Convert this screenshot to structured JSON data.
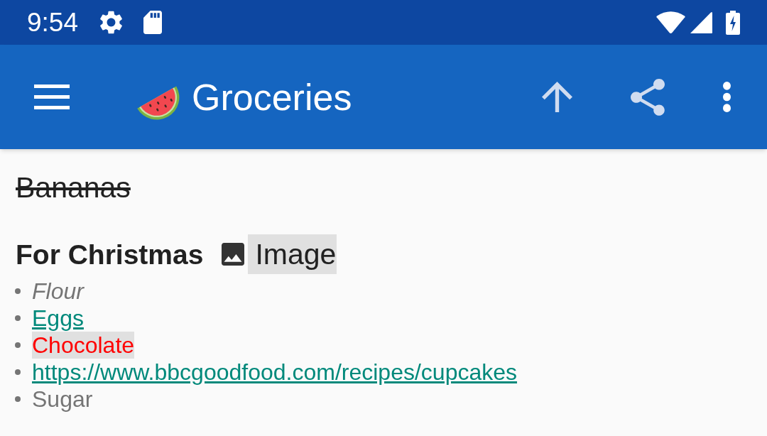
{
  "status_bar": {
    "time": "9:54"
  },
  "app_bar": {
    "title": "Groceries"
  },
  "note": {
    "blocks": [
      {
        "kind": "paragraph",
        "text": "Bananas",
        "struck": true
      },
      {
        "kind": "heading",
        "text": "For Christmas",
        "attachment": "Image"
      },
      {
        "kind": "list",
        "items": [
          {
            "kind": "italic",
            "text": "Flour"
          },
          {
            "kind": "link",
            "text": "Eggs"
          },
          {
            "kind": "highlight",
            "text": "Chocolate",
            "color": "#ff0000"
          },
          {
            "kind": "link",
            "text": "https://www.bbcgoodfood.com/recipes/cupcakes"
          },
          {
            "kind": "plain",
            "text": "Sugar"
          }
        ]
      }
    ]
  }
}
